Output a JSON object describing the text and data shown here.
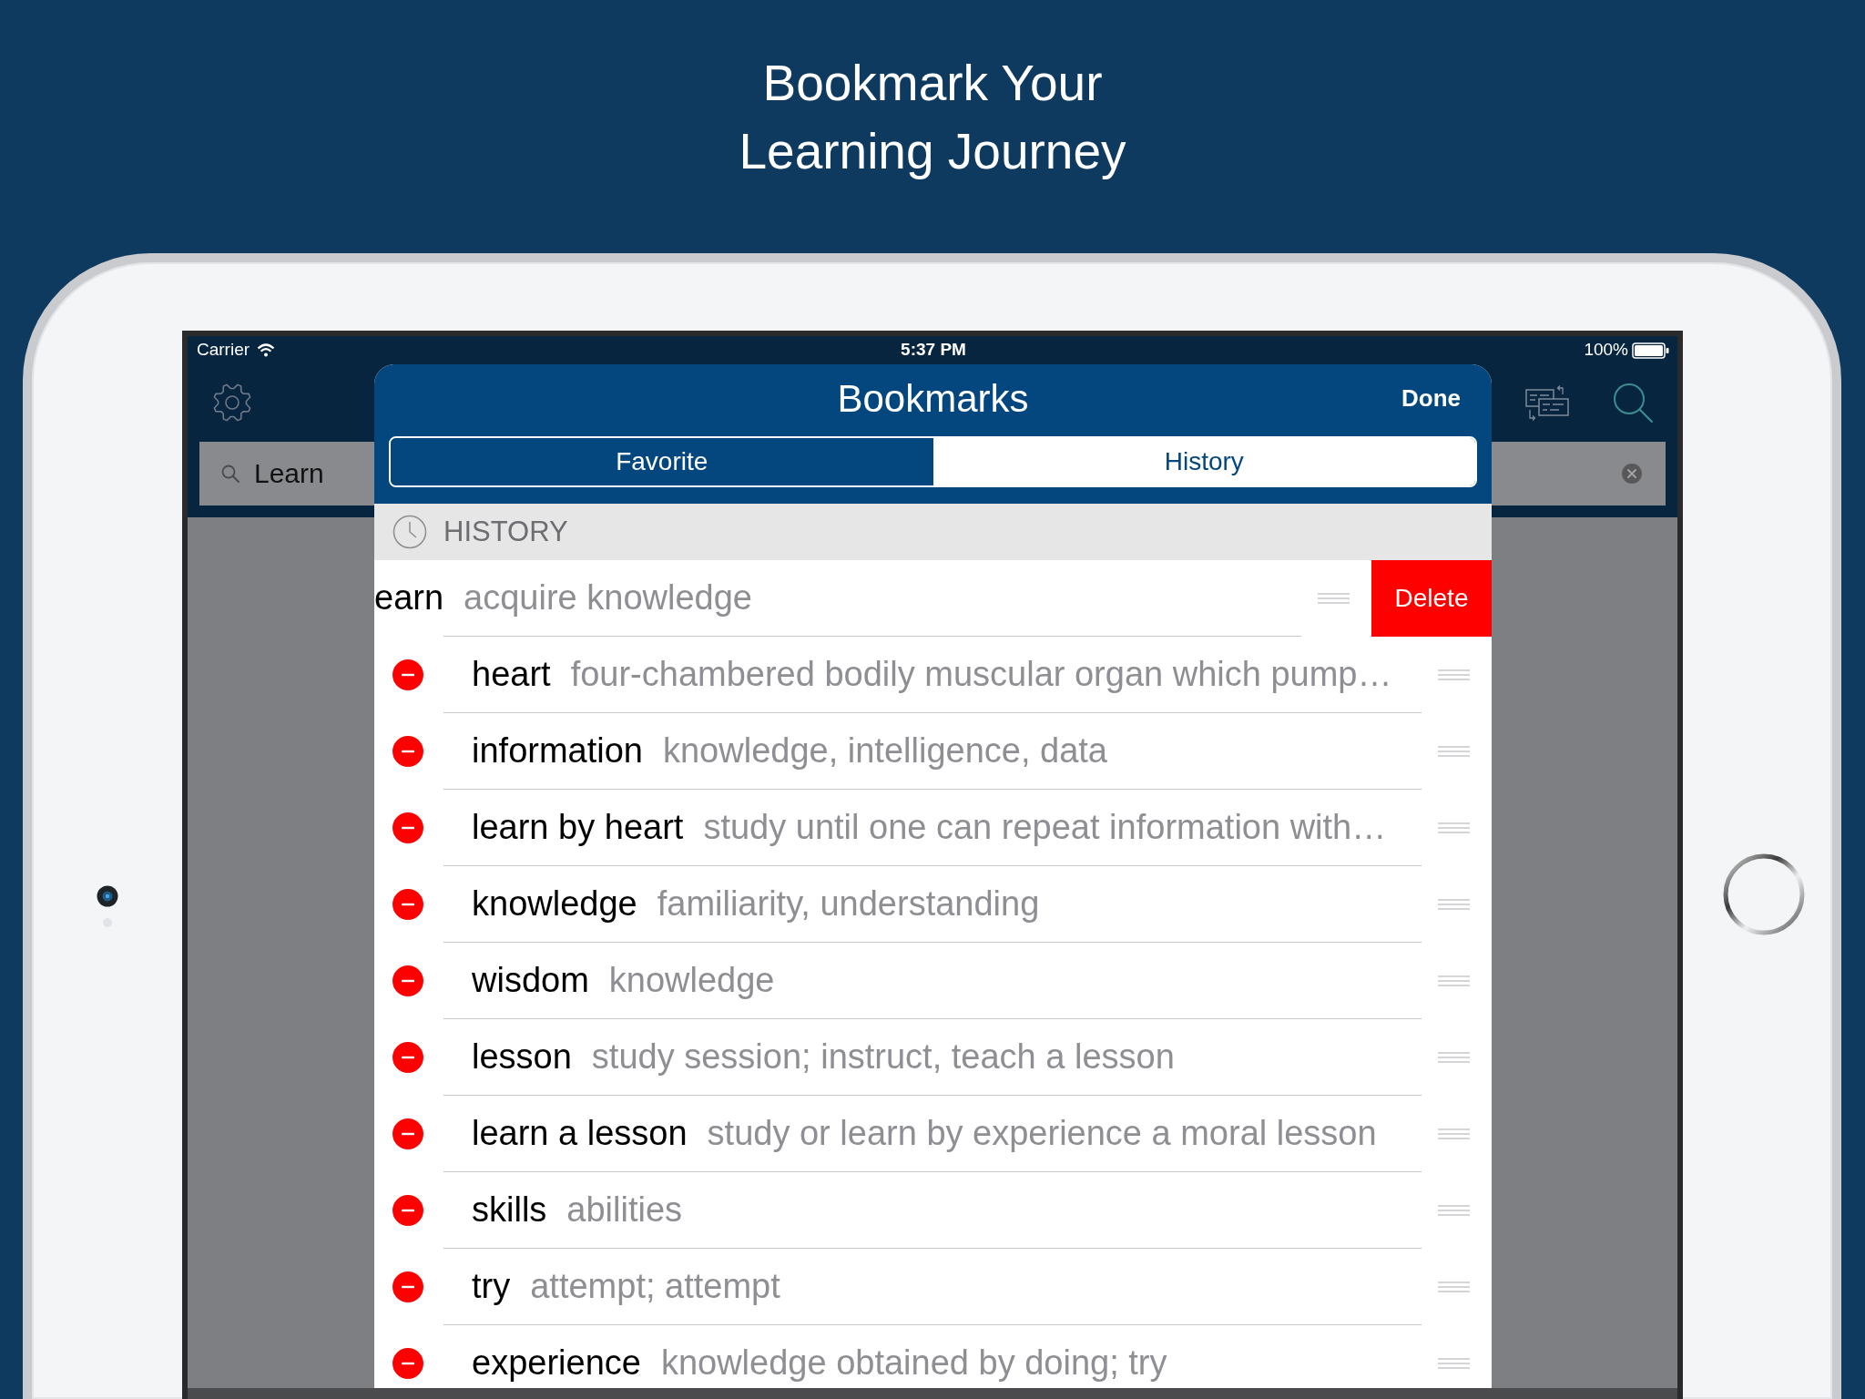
{
  "headline": [
    "Bookmark Your",
    "Learning Journey"
  ],
  "status_bar": {
    "carrier": "Carrier",
    "time": "5:37 PM",
    "battery": "100%"
  },
  "search": {
    "value": "Learn"
  },
  "bookmarks_sheet": {
    "title": "Bookmarks",
    "done_button": "Done",
    "segments": [
      {
        "label": "Favorite",
        "selected": false
      },
      {
        "label": "History",
        "selected": true
      }
    ],
    "section_header": "HISTORY",
    "delete_label": "Delete",
    "rows": [
      {
        "word": "earn",
        "definition": "acquire knowledge",
        "swiped": true
      },
      {
        "word": "heart",
        "definition": "four-chambered bodily muscular organ which pump…",
        "swiped": false
      },
      {
        "word": "information",
        "definition": "knowledge, intelligence, data",
        "swiped": false
      },
      {
        "word": "learn by heart",
        "definition": "study until one can repeat information with…",
        "swiped": false
      },
      {
        "word": "knowledge",
        "definition": "familiarity, understanding",
        "swiped": false
      },
      {
        "word": "wisdom",
        "definition": "knowledge",
        "swiped": false
      },
      {
        "word": "lesson",
        "definition": "study session; instruct, teach a lesson",
        "swiped": false
      },
      {
        "word": "learn a lesson",
        "definition": "study or learn by experience a moral lesson",
        "swiped": false
      },
      {
        "word": "skills",
        "definition": "abilities",
        "swiped": false
      },
      {
        "word": "try",
        "definition": "attempt; attempt",
        "swiped": false
      },
      {
        "word": "experience",
        "definition": "knowledge obtained by doing; try",
        "swiped": false
      }
    ]
  }
}
